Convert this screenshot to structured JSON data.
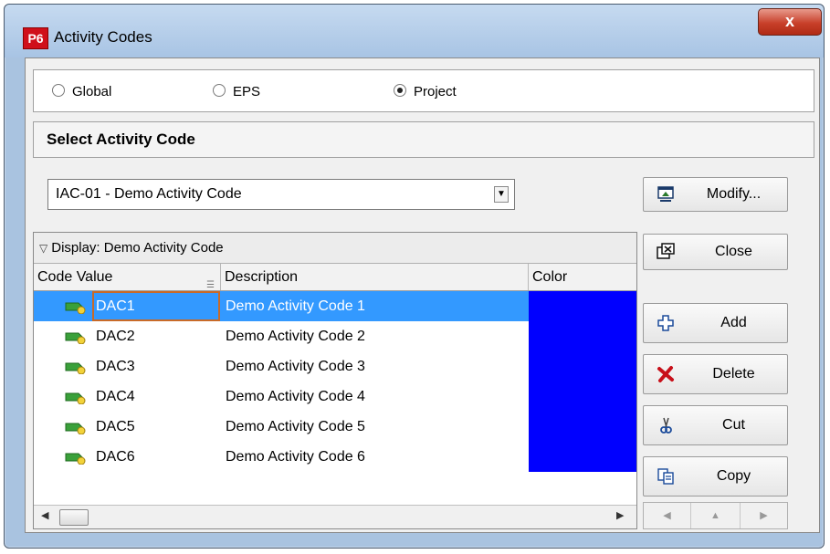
{
  "window": {
    "icon_label": "P6",
    "title": "Activity Codes",
    "close_label": "x"
  },
  "scope": {
    "options": [
      {
        "label": "Global",
        "selected": false
      },
      {
        "label": "EPS",
        "selected": false
      },
      {
        "label": "Project",
        "selected": true
      }
    ]
  },
  "select_section": {
    "title": "Select Activity Code"
  },
  "code_select": {
    "value": "IAC-01 - Demo Activity Code"
  },
  "buttons": {
    "modify": "Modify...",
    "close": "Close",
    "add": "Add",
    "delete": "Delete",
    "cut": "Cut",
    "copy": "Copy"
  },
  "grid": {
    "display_label": "Display: Demo Activity Code",
    "columns": [
      "Code Value",
      "Description",
      "Color"
    ],
    "rows": [
      {
        "code": "DAC1",
        "description": "Demo Activity Code 1",
        "color": "#0000ff",
        "selected": true
      },
      {
        "code": "DAC2",
        "description": "Demo Activity Code 2",
        "color": "#0000ff",
        "selected": false
      },
      {
        "code": "DAC3",
        "description": "Demo Activity Code 3",
        "color": "#0000ff",
        "selected": false
      },
      {
        "code": "DAC4",
        "description": "Demo Activity Code 4",
        "color": "#0000ff",
        "selected": false
      },
      {
        "code": "DAC5",
        "description": "Demo Activity Code 5",
        "color": "#0000ff",
        "selected": false
      },
      {
        "code": "DAC6",
        "description": "Demo Activity Code 6",
        "color": "#0000ff",
        "selected": false
      }
    ]
  },
  "colors": {
    "selection": "#3399ff",
    "code_color": "#0000ff",
    "title_close": "#c8402a"
  },
  "icons": {
    "row": "activity-code-tag-icon",
    "modify": "modify-window-icon",
    "close": "close-window-icon",
    "add": "plus-icon",
    "delete": "red-x-icon",
    "cut": "scissors-icon",
    "copy": "copy-icon"
  }
}
